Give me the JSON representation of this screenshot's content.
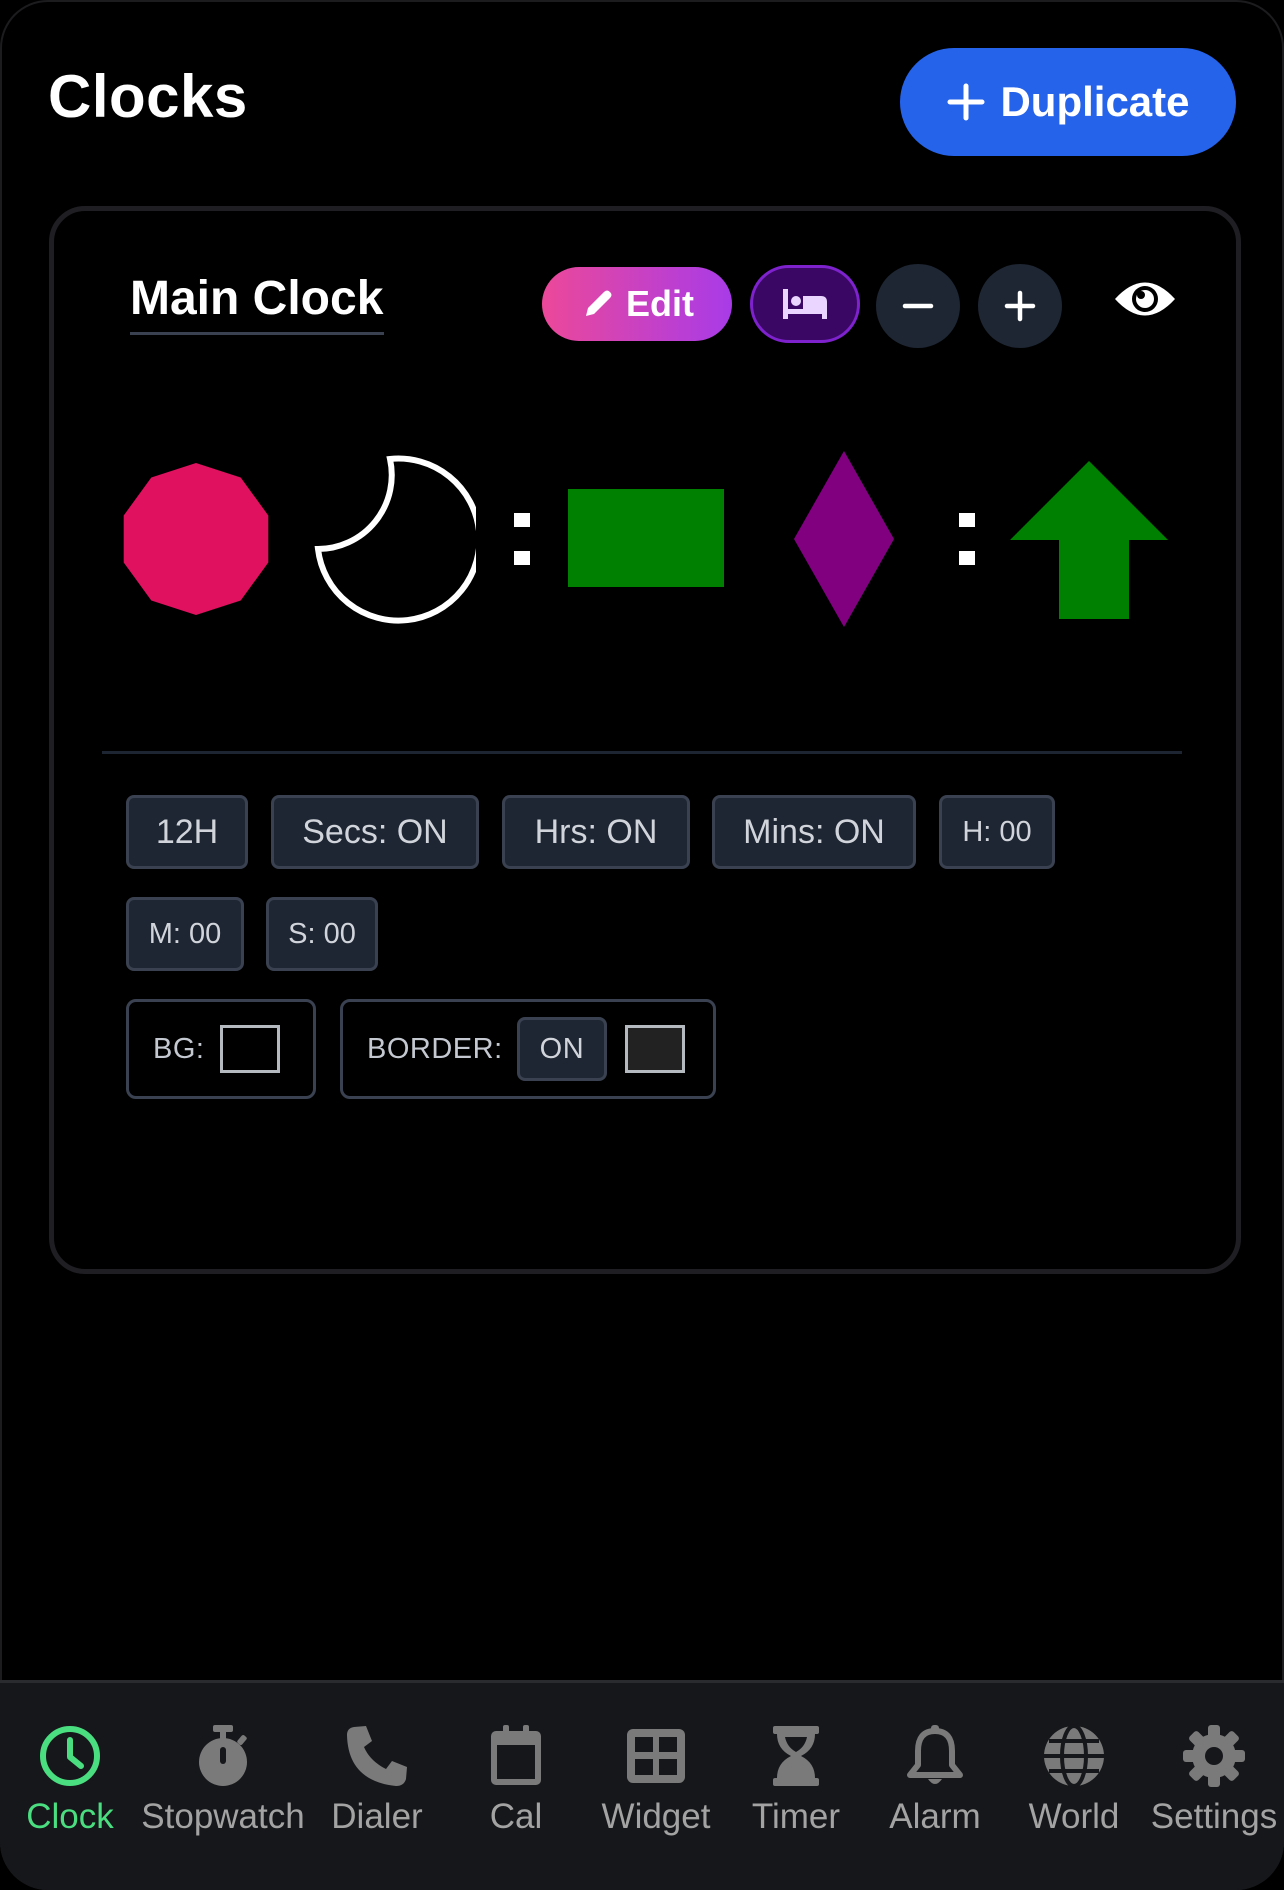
{
  "header": {
    "title": "Clocks",
    "duplicate_label": "Duplicate"
  },
  "clock_card": {
    "name": "Main Clock",
    "edit_label": "Edit",
    "separator": ":",
    "options": {
      "format": "12H",
      "secs": "Secs: ON",
      "hrs": "Hrs: ON",
      "mins": "Mins: ON",
      "h_offset": "H: 00",
      "m_offset": "M: 00",
      "s_offset": "S: 00",
      "bg_label": "BG:",
      "border_label": "BORDER:",
      "border_toggle": "ON"
    },
    "colors": {
      "decagon": "#e0115f",
      "rectangle": "#008000",
      "diamond": "#800080",
      "arrow": "#008000",
      "crescent": "#ffffff",
      "bg_swatch": "#000000",
      "border_swatch": "#222222"
    }
  },
  "bottom_nav": {
    "active": "Clock",
    "items": [
      {
        "label": "Clock",
        "icon": "clock-icon"
      },
      {
        "label": "Stopwatch",
        "icon": "stopwatch-icon"
      },
      {
        "label": "Dialer",
        "icon": "phone-icon"
      },
      {
        "label": "Cal",
        "icon": "calendar-icon"
      },
      {
        "label": "Widget",
        "icon": "grid-icon"
      },
      {
        "label": "Timer",
        "icon": "hourglass-icon"
      },
      {
        "label": "Alarm",
        "icon": "bell-icon"
      },
      {
        "label": "World",
        "icon": "globe-icon"
      },
      {
        "label": "Settings",
        "icon": "gear-icon"
      }
    ]
  },
  "accent": {
    "primary": "#2563eb",
    "nav_active": "#4ade80"
  }
}
